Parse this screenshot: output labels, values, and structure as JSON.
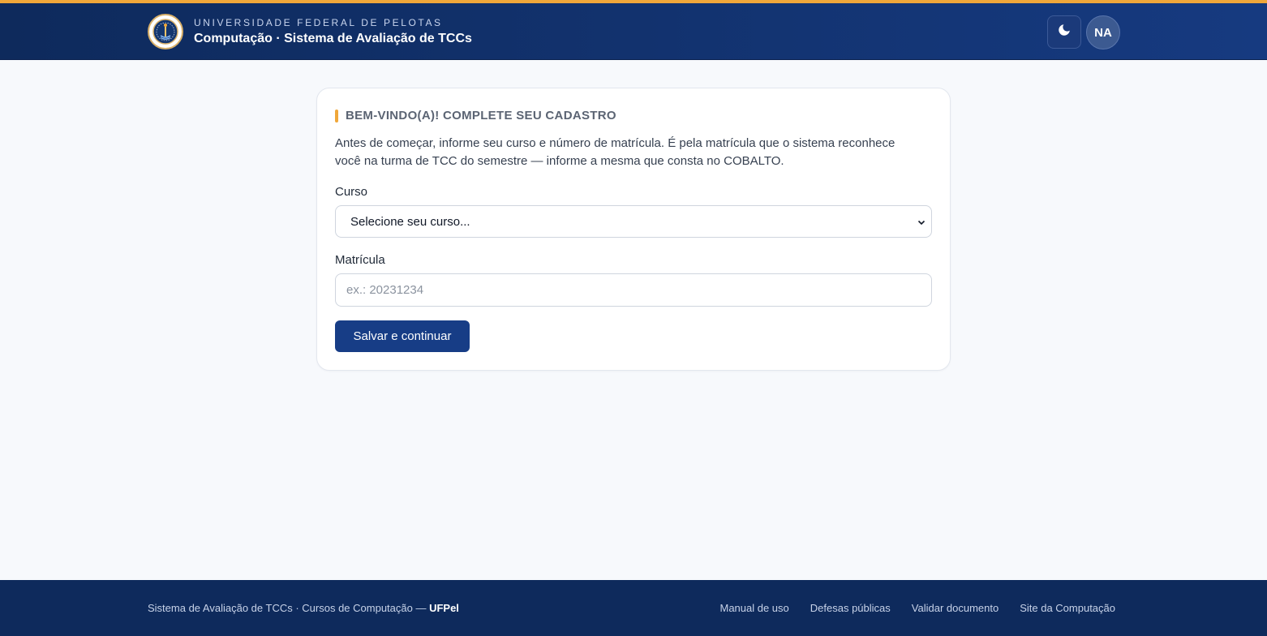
{
  "header": {
    "institution": "UNIVERSIDADE FEDERAL DE PELOTAS",
    "system_title": "Computação · Sistema de Avaliação de TCCs",
    "theme_icon": "moon-icon",
    "avatar_initials": "NA"
  },
  "card": {
    "heading": "BEM-VINDO(A)! COMPLETE SEU CADASTRO",
    "intro": "Antes de começar, informe seu curso e número de matrícula. É pela matrícula que o sistema reconhece você na turma de TCC do semestre — informe a mesma que consta no COBALTO.",
    "curso_label": "Curso",
    "curso_selected": "Selecione seu curso...",
    "matricula_label": "Matrícula",
    "matricula_placeholder": "ex.: 20231234",
    "matricula_value": "",
    "submit_label": "Salvar e continuar"
  },
  "footer": {
    "left_text": "Sistema de Avaliação de TCCs · Cursos de Computação — ",
    "left_bold": "UFPel",
    "links": [
      "Manual de uso",
      "Defesas públicas",
      "Validar documento",
      "Site da Computação"
    ]
  },
  "colors": {
    "header_bg": "#0e2a5c",
    "accent": "#f0a73a",
    "primary_button": "#173d86",
    "page_bg": "#f7f9fc"
  }
}
